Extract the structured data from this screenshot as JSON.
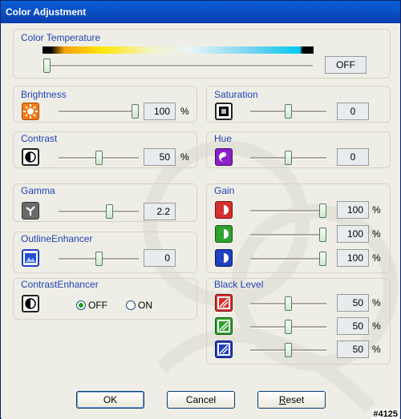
{
  "window": {
    "title": "Color Adjustment"
  },
  "color_temperature": {
    "label": "Color Temperature",
    "value": "OFF",
    "level": 0.0
  },
  "brightness": {
    "label": "Brightness",
    "value": "100",
    "unit": "%",
    "level": 1.0
  },
  "contrast": {
    "label": "Contrast",
    "value": "50",
    "unit": "%",
    "level": 0.5
  },
  "gamma": {
    "label": "Gamma",
    "value": "2.2",
    "level": 0.65
  },
  "outline_enhancer": {
    "label": "OutlineEnhancer",
    "value": "0",
    "level": 0.5
  },
  "contrast_enhancer": {
    "label": "ContrastEnhancer",
    "option_off": "OFF",
    "option_on": "ON",
    "selected": "OFF"
  },
  "saturation": {
    "label": "Saturation",
    "value": "0",
    "level": 0.5
  },
  "hue": {
    "label": "Hue",
    "value": "0",
    "level": 0.5
  },
  "gain": {
    "label": "Gain",
    "red": {
      "value": "100",
      "unit": "%",
      "level": 1.0
    },
    "green": {
      "value": "100",
      "unit": "%",
      "level": 1.0
    },
    "blue": {
      "value": "100",
      "unit": "%",
      "level": 1.0
    }
  },
  "black_level": {
    "label": "Black Level",
    "red": {
      "value": "50",
      "unit": "%",
      "level": 0.5
    },
    "green": {
      "value": "50",
      "unit": "%",
      "level": 0.5
    },
    "blue": {
      "value": "50",
      "unit": "%",
      "level": 0.5
    }
  },
  "buttons": {
    "ok": "OK",
    "cancel": "Cancel",
    "reset": "Reset"
  },
  "watermark": "#4125",
  "colors": {
    "title_accent": "#1f42b8",
    "titlebar": "#0a4fc9",
    "red": "#d32f2f",
    "green": "#2ea12e",
    "blue": "#1f3fbf",
    "orange": "#f07a1a",
    "purple": "#8a1fc4"
  }
}
